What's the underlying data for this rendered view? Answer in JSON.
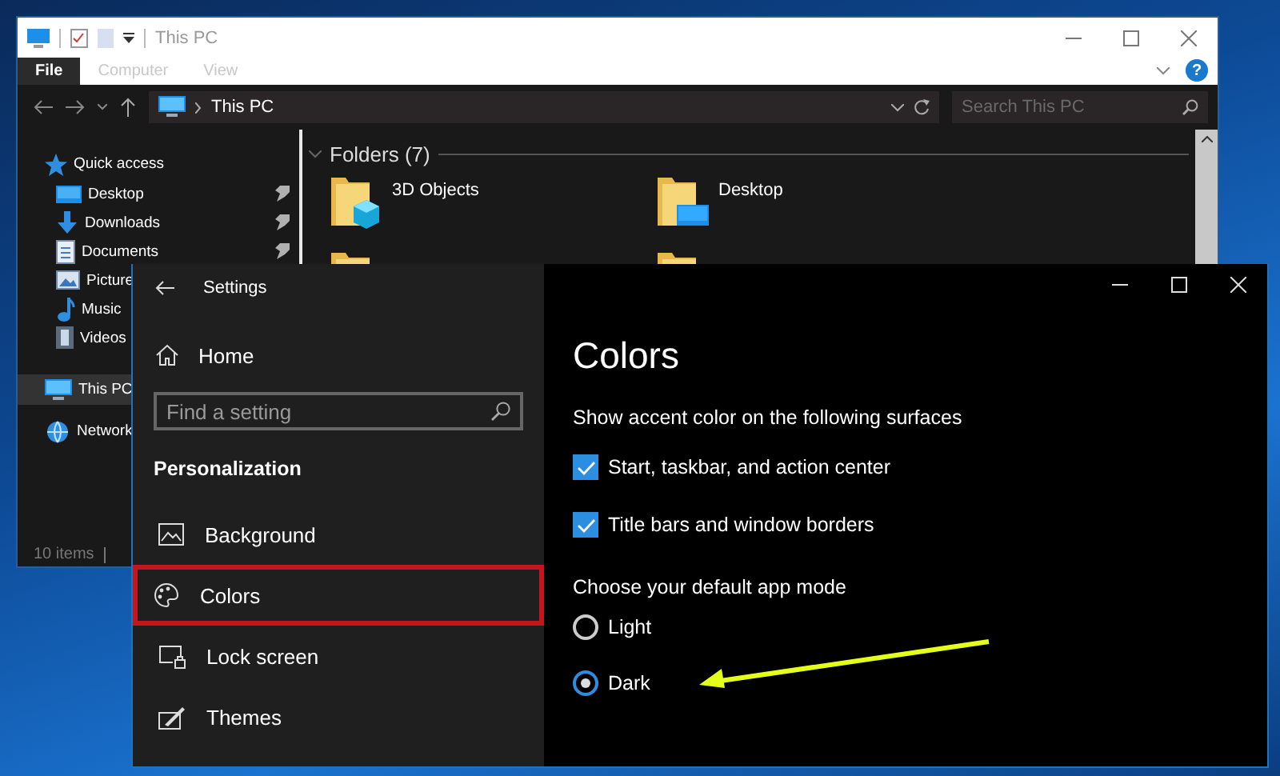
{
  "explorer": {
    "title": "This PC",
    "ribbon_tabs": [
      {
        "label": "File",
        "selected": true
      },
      {
        "label": "Computer",
        "selected": false
      },
      {
        "label": "View",
        "selected": false
      }
    ],
    "help_label": "?",
    "address": {
      "path": "This PC",
      "search_placeholder": "Search This PC"
    },
    "nav": [
      {
        "label": "Quick access",
        "kind": "star",
        "pinned": false,
        "selected": false,
        "children": [
          {
            "label": "Desktop",
            "kind": "desktop",
            "pinned": true,
            "selected": false
          },
          {
            "label": "Downloads",
            "kind": "download",
            "pinned": true,
            "selected": false
          },
          {
            "label": "Documents",
            "kind": "document",
            "pinned": true,
            "selected": false
          },
          {
            "label": "Picture",
            "kind": "picture",
            "selected": false
          },
          {
            "label": "Music",
            "kind": "music",
            "selected": false
          },
          {
            "label": "Videos",
            "kind": "video",
            "selected": false
          }
        ]
      },
      {
        "label": "This PC",
        "kind": "pc",
        "selected": true
      },
      {
        "label": "Network",
        "kind": "network",
        "selected": false
      }
    ],
    "group": {
      "title": "Folders (7)",
      "expanded": true
    },
    "folders": [
      {
        "label": "3D Objects",
        "kind": "cube"
      },
      {
        "label": "Desktop",
        "kind": "desktop"
      }
    ],
    "status": "10 items"
  },
  "settings": {
    "title": "Settings",
    "home": "Home",
    "search_placeholder": "Find a setting",
    "section": "Personalization",
    "items": [
      {
        "label": "Background",
        "kind": "picture",
        "selected": false
      },
      {
        "label": "Colors",
        "kind": "palette",
        "selected": true
      },
      {
        "label": "Lock screen",
        "kind": "lock",
        "selected": false
      },
      {
        "label": "Themes",
        "kind": "brush",
        "selected": false
      }
    ],
    "page": {
      "title": "Colors",
      "accent_heading": "Show accent color on the following surfaces",
      "checkboxes": [
        {
          "label": "Start, taskbar, and action center",
          "checked": true
        },
        {
          "label": "Title bars and window borders",
          "checked": true
        }
      ],
      "mode_heading": "Choose your default app mode",
      "modes": [
        {
          "label": "Light",
          "selected": false
        },
        {
          "label": "Dark",
          "selected": true
        }
      ]
    }
  }
}
